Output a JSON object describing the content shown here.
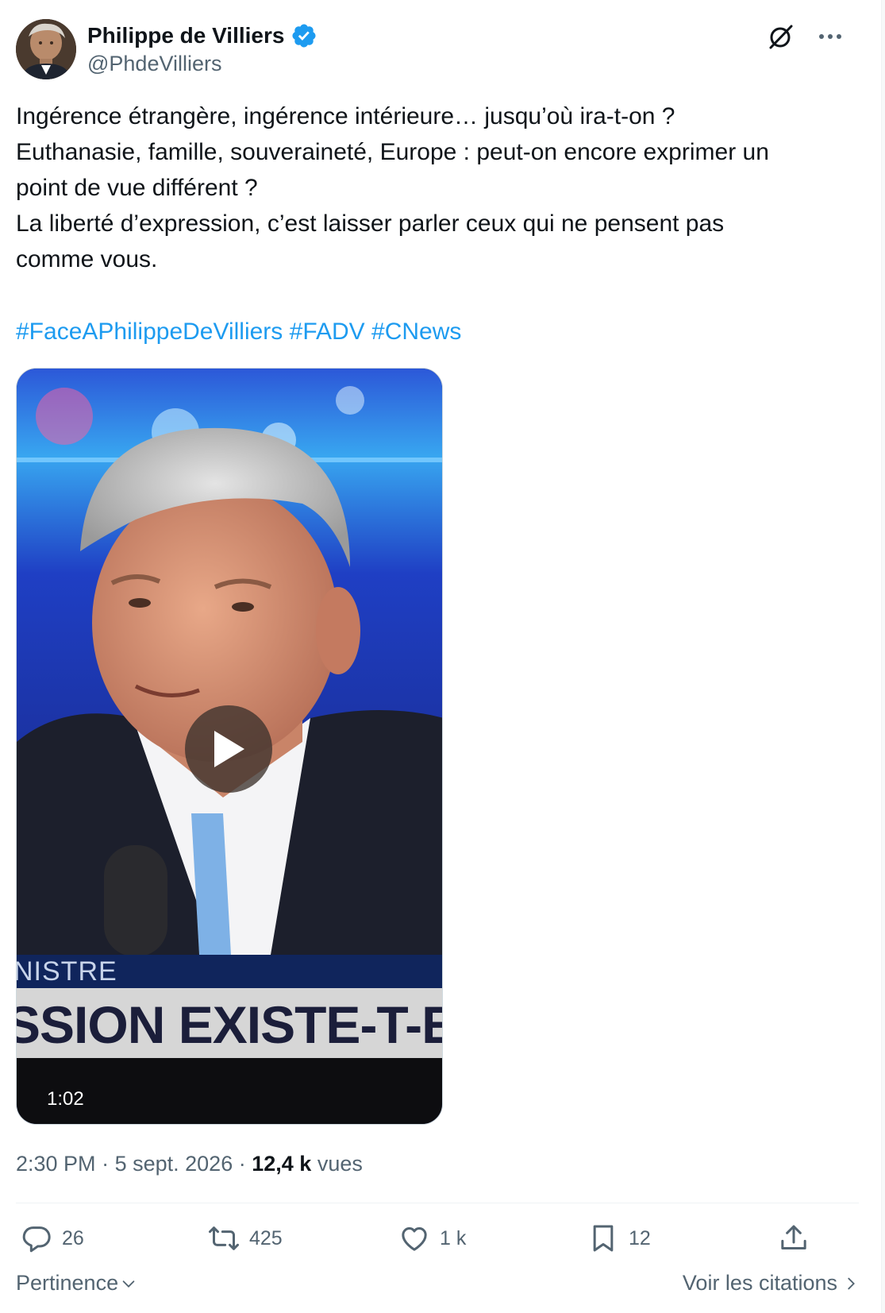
{
  "author": {
    "display_name": "Philippe de Villiers",
    "handle": "@PhdeVilliers",
    "verified": true
  },
  "tweet": {
    "lines": [
      "Ingérence étrangère, ingérence intérieure… jusqu’où ira-t-on ?",
      "Euthanasie, famille, souveraineté, Europe : peut-on encore exprimer un",
      "point de vue différent ?",
      "La liberté d’expression, c’est laisser parler ceux qui ne pensent pas",
      "comme vous."
    ],
    "hashtags": [
      "#FaceAPhilippeDeVilliers",
      "#FADV",
      "#CNews"
    ]
  },
  "video": {
    "banner_top": "NISTRE",
    "banner_main": "SSION EXISTE-T-ELLE",
    "duration": "1:02"
  },
  "meta": {
    "time": "2:30 PM",
    "separator": "·",
    "date": "5 sept. 2026",
    "views_count": "12,4 k",
    "views_label": "vues"
  },
  "actions": {
    "replies": "26",
    "reposts": "425",
    "likes": "1 k",
    "bookmarks": "12"
  },
  "footer": {
    "sort_label": "Pertinence",
    "quotes_label": "Voir les citations"
  },
  "icons": {
    "verified": "verified-badge-icon",
    "grok": "grok-icon",
    "more": "more-icon",
    "play": "play-icon",
    "reply": "reply-icon",
    "repost": "repost-icon",
    "like": "like-icon",
    "bookmark": "bookmark-icon",
    "share": "share-icon"
  },
  "colors": {
    "accent": "#1d9bf0",
    "text_primary": "#0f1419",
    "text_secondary": "#536471"
  }
}
